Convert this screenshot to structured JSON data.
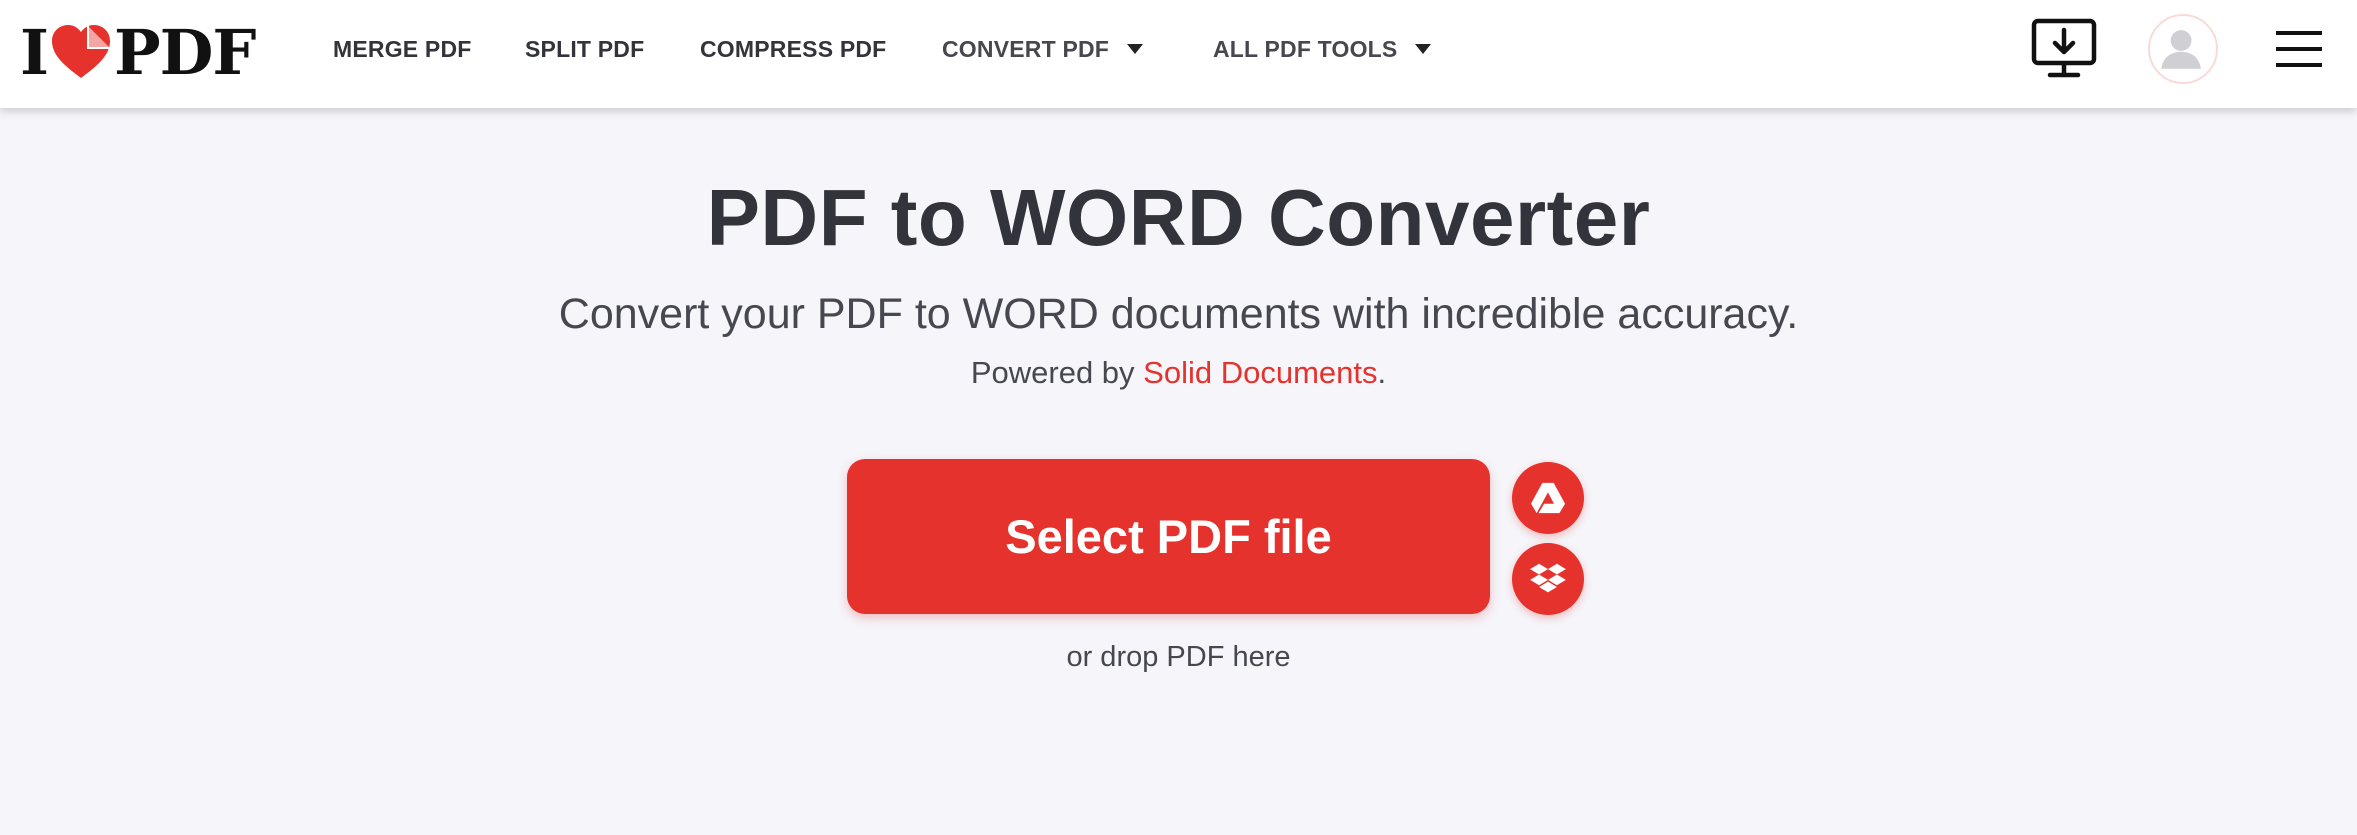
{
  "header": {
    "logo": {
      "left": "I",
      "right": "PDF"
    },
    "nav": [
      {
        "label": "MERGE PDF"
      },
      {
        "label": "SPLIT PDF"
      },
      {
        "label": "COMPRESS PDF"
      },
      {
        "label": "CONVERT PDF",
        "has_dropdown": true
      },
      {
        "label": "ALL PDF TOOLS",
        "has_dropdown": true
      }
    ],
    "icons": [
      "desktop-download-icon",
      "user-avatar-icon",
      "hamburger-menu-icon"
    ]
  },
  "main": {
    "title": "PDF to WORD Converter",
    "subtitle": "Convert your PDF to WORD documents with incredible accuracy.",
    "powered_prefix": "Powered by ",
    "powered_link": "Solid Documents",
    "powered_suffix": ".",
    "select_button": "Select PDF file",
    "cloud_sources": [
      "google-drive-icon",
      "dropbox-icon"
    ],
    "drop_hint": "or drop PDF here"
  },
  "colors": {
    "accent": "#e5322d",
    "background": "#f5f5fa",
    "text": "#33333b"
  }
}
